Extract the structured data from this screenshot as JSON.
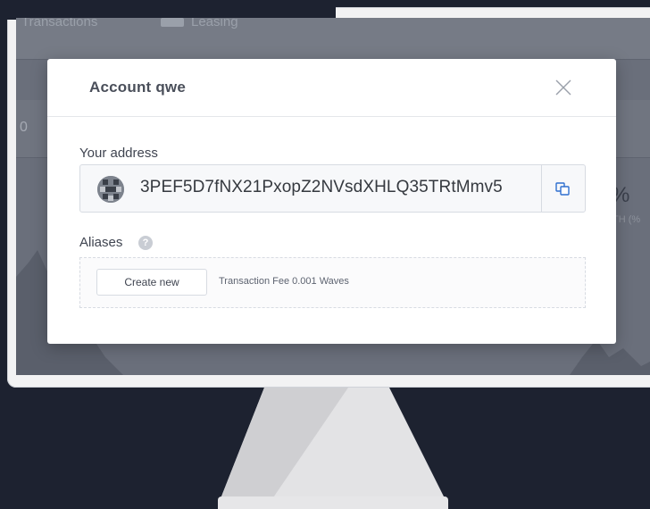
{
  "background_app": {
    "nav_transactions": "Transactions",
    "nav_leasing": "Leasing",
    "partial_zero": "0",
    "partial_percent": "%",
    "partial_growth": "TH (%"
  },
  "modal": {
    "title": "Account qwe",
    "address_label": "Your address",
    "address": "3PEF5D7fNX21PxopZ2NVsdXHLQ35TRtMmv5",
    "aliases_label": "Aliases",
    "help_glyph": "?",
    "create_new_label": "Create new",
    "transaction_fee": "Transaction Fee 0.001 Waves"
  },
  "icons": {
    "close": "close-icon",
    "copy": "copy-icon",
    "help": "help-icon",
    "avatar": "identicon-avatar"
  },
  "colors": {
    "page_background": "#1d2230",
    "modal_background": "#ffffff",
    "copy_icon": "#2f6fcf"
  }
}
